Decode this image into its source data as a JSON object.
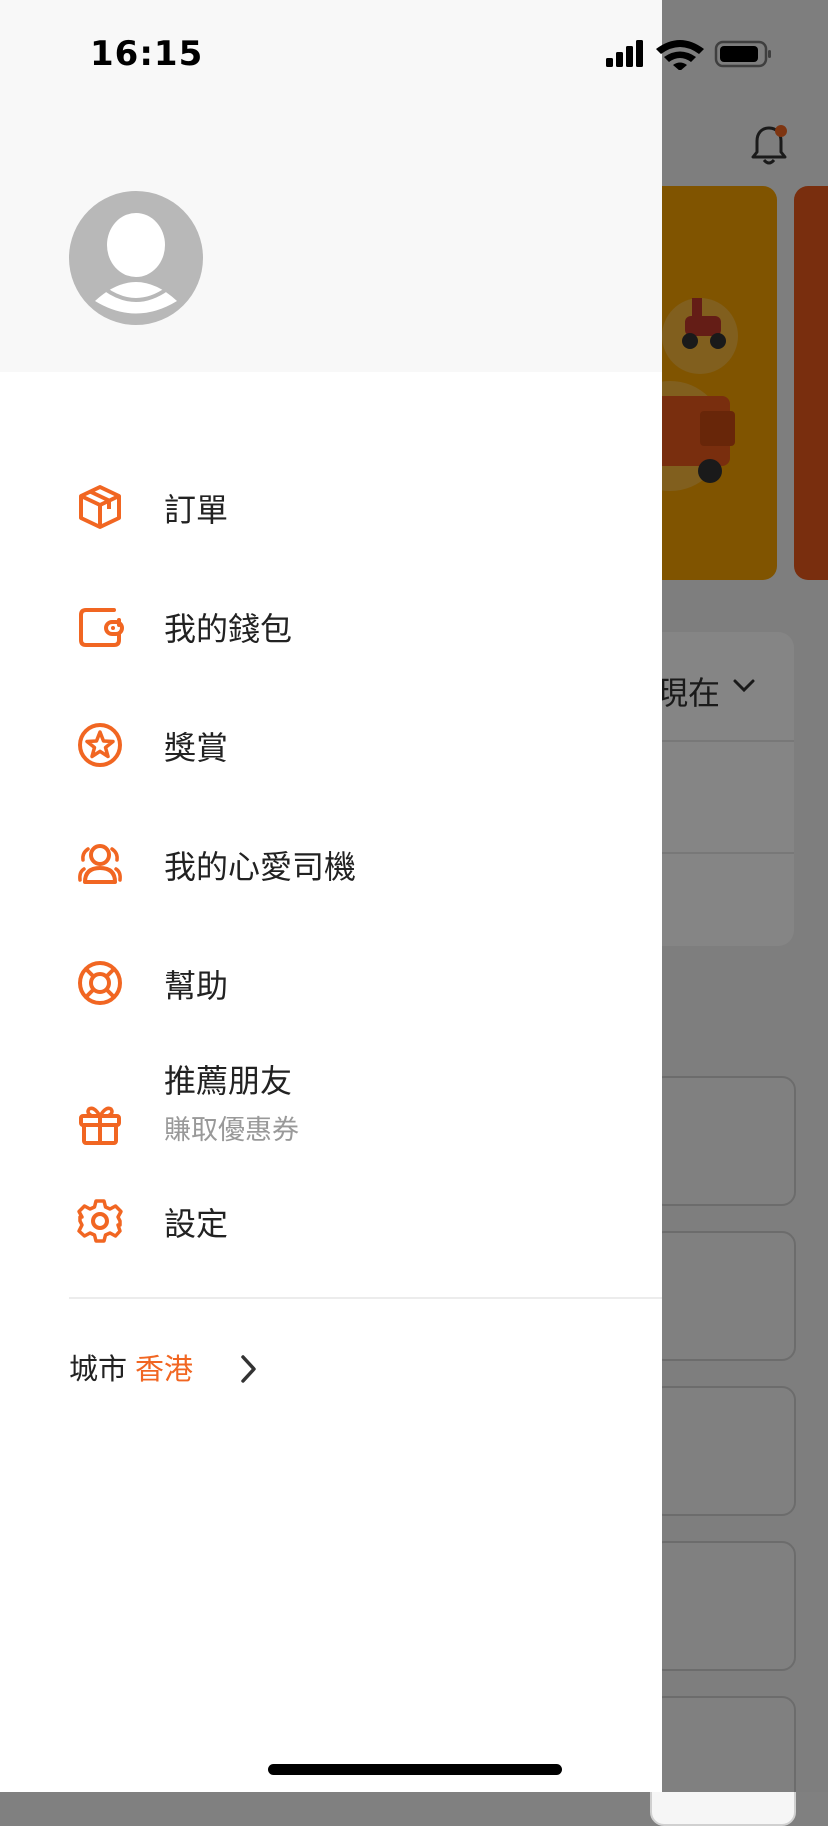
{
  "status_bar": {
    "time": "16:15"
  },
  "background": {
    "card_text": "現在"
  },
  "menu": {
    "items": [
      {
        "label": "訂單",
        "icon": "package-icon"
      },
      {
        "label": "我的錢包",
        "icon": "wallet-icon"
      },
      {
        "label": "獎賞",
        "icon": "star-badge-icon"
      },
      {
        "label": "我的心愛司機",
        "icon": "drivers-icon"
      },
      {
        "label": "幫助",
        "icon": "lifebuoy-icon"
      },
      {
        "label": "推薦朋友",
        "sublabel": "賺取優惠券",
        "icon": "gift-icon"
      },
      {
        "label": "設定",
        "icon": "gear-icon"
      }
    ]
  },
  "city": {
    "label": "城市",
    "value": "香港"
  },
  "colors": {
    "accent": "#f16622",
    "avatar": "#b8b8b8"
  }
}
